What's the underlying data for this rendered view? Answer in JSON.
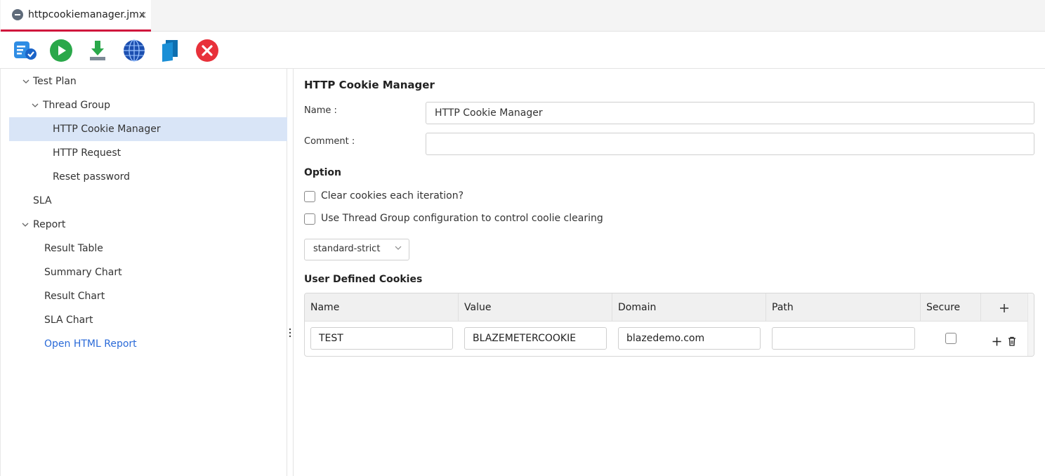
{
  "tab": {
    "title": "httpcookiemanager.jmx",
    "close": "×"
  },
  "toolbar": [
    {
      "icon": "list-check-icon"
    },
    {
      "icon": "play-icon"
    },
    {
      "icon": "download-icon"
    },
    {
      "icon": "globe-icon"
    },
    {
      "icon": "copy-icon"
    },
    {
      "icon": "close-icon"
    }
  ],
  "tree": {
    "test_plan": "Test Plan",
    "thread_group": "Thread Group",
    "cookie_manager": "HTTP Cookie Manager",
    "http_request": "HTTP Request",
    "reset_password": "Reset password",
    "sla": "SLA",
    "report": "Report",
    "result_table": "Result Table",
    "summary_chart": "Summary Chart",
    "result_chart": "Result Chart",
    "sla_chart": "SLA Chart",
    "open_html_report": "Open HTML Report"
  },
  "form": {
    "title": "HTTP Cookie Manager",
    "name_label": "Name :",
    "name_value": "HTTP Cookie Manager",
    "comment_label": "Comment :",
    "comment_value": "",
    "option_heading": "Option",
    "clear_cookies": "Clear cookies each iteration?",
    "use_thread_group": "Use Thread Group configuration to control coolie clearing",
    "policy_value": "standard-strict",
    "cookies_heading": "User Defined Cookies"
  },
  "cookies": {
    "headers": {
      "name": "Name",
      "value": "Value",
      "domain": "Domain",
      "path": "Path",
      "secure": "Secure"
    },
    "rows": [
      {
        "name": "TEST",
        "value": "BLAZEMETERCOOKIE",
        "domain": "blazedemo.com",
        "path": "",
        "secure": false
      }
    ]
  },
  "colors": {
    "accent": "#d0143c",
    "selected": "#d9e5f7",
    "link": "#2a6ad8"
  }
}
